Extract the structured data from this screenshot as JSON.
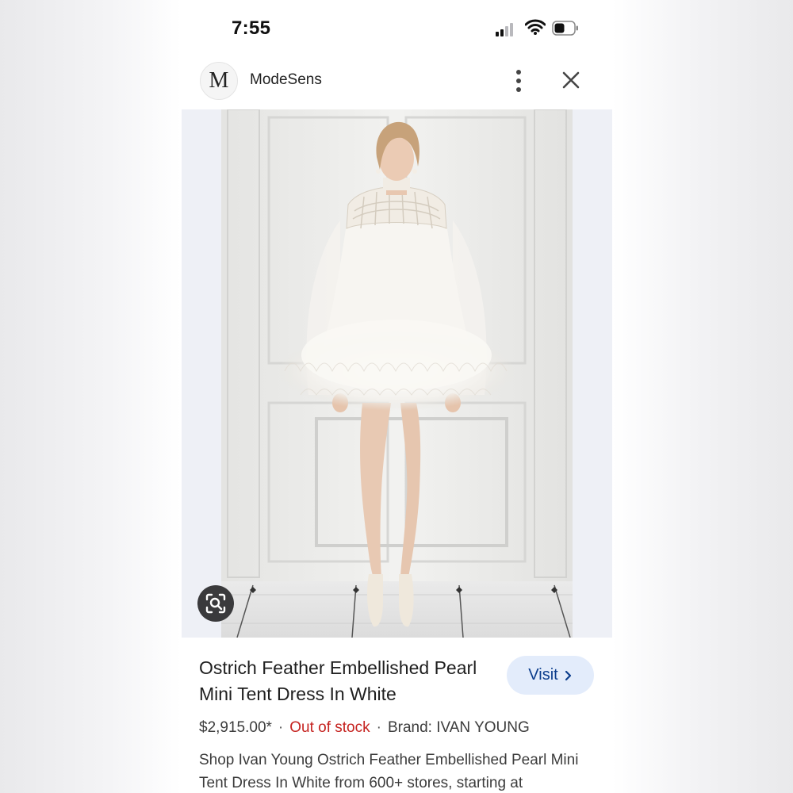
{
  "status_bar": {
    "time": "7:55",
    "signal_icon": "cellular-signal-icon",
    "wifi_icon": "wifi-icon",
    "battery_icon": "battery-icon",
    "battery_level": 0.4
  },
  "header": {
    "logo_letter": "M",
    "site_name": "ModeSens",
    "more_icon": "more-vertical-icon",
    "close_icon": "close-icon"
  },
  "image": {
    "lens_icon": "google-lens-icon"
  },
  "product": {
    "title": "Ostrich Feather Embellished Pearl Mini Tent Dress In White",
    "visit_label": "Visit",
    "visit_icon": "chevron-right-icon",
    "price": "$2,915.00*",
    "separator": "·",
    "stock": "Out of stock",
    "brand": "Brand: IVAN YOUNG",
    "description": "Shop Ivan Young Ostrich Feather Embellished Pearl Mini Tent Dress In White from 600+ stores, starting at"
  },
  "colors": {
    "visit_bg": "#e3ecfb",
    "visit_text": "#0b3d8c",
    "stock_red": "#c5221f"
  }
}
